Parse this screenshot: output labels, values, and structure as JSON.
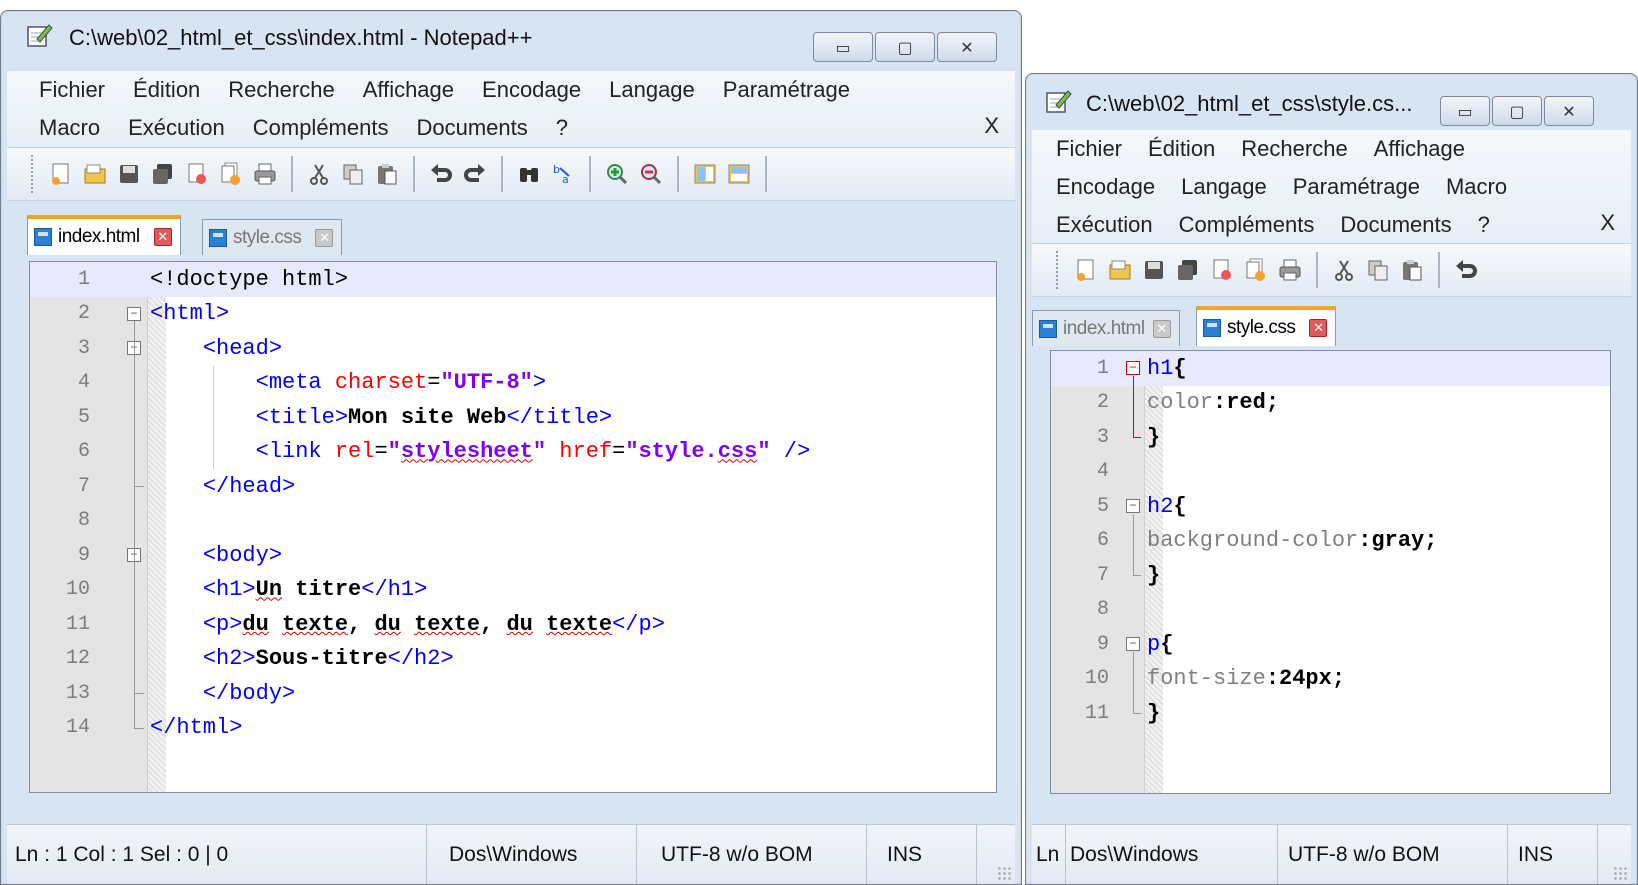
{
  "window1": {
    "title": "C:\\web\\02_html_et_css\\index.html - Notepad++",
    "controls": [
      "▭",
      "▢",
      "✕"
    ],
    "menu_row1": [
      "Fichier",
      "Édition",
      "Recherche",
      "Affichage",
      "Encodage",
      "Langage",
      "Paramétrage"
    ],
    "menu_row2": [
      "Macro",
      "Exécution",
      "Compléments",
      "Documents",
      "?"
    ],
    "menu_close": "X",
    "tabs": [
      {
        "label": "index.html",
        "active": true
      },
      {
        "label": "style.css",
        "active": false
      }
    ],
    "line_numbers": [
      "1",
      "2",
      "3",
      "4",
      "5",
      "6",
      "7",
      "8",
      "9",
      "10",
      "11",
      "12",
      "13",
      "14"
    ],
    "code_lines": [
      "<!doctype html>",
      "<html>",
      "    <head>",
      "        <meta charset=\"UTF-8\">",
      "        <title>Mon site Web</title>",
      "        <link rel=\"stylesheet\" href=\"style.css\" />",
      "    </head>",
      "",
      "    <body>",
      "    <h1>Un titre</h1>",
      "    <p>du texte, du texte, du texte</p>",
      "    <h2>Sous-titre</h2>",
      "    </body>",
      "</html>"
    ],
    "status": {
      "position": "Ln : 1    Col : 1    Sel : 0 | 0",
      "eol": "Dos\\Windows",
      "encoding": "UTF-8 w/o BOM",
      "mode": "INS"
    }
  },
  "window2": {
    "title": "C:\\web\\02_html_et_css\\style.cs...",
    "controls": [
      "▭",
      "▢",
      "✕"
    ],
    "menu_row1": [
      "Fichier",
      "Édition",
      "Recherche",
      "Affichage"
    ],
    "menu_row2": [
      "Encodage",
      "Langage",
      "Paramétrage",
      "Macro"
    ],
    "menu_row3": [
      "Exécution",
      "Compléments",
      "Documents",
      "?"
    ],
    "menu_close": "X",
    "tabs": [
      {
        "label": "index.html",
        "active": false
      },
      {
        "label": "style.css",
        "active": true
      }
    ],
    "line_numbers": [
      "1",
      "2",
      "3",
      "4",
      "5",
      "6",
      "7",
      "8",
      "9",
      "10",
      "11"
    ],
    "code_lines": [
      "h1{",
      "color:red;",
      "}",
      "",
      "h2{",
      "background-color:gray;",
      "}",
      "",
      "p{",
      "font-size:24px;",
      "}"
    ],
    "status": {
      "position": "Ln",
      "eol": "Dos\\Windows",
      "encoding": "UTF-8 w/o BOM",
      "mode": "INS"
    }
  },
  "toolbar_icons": [
    "new-file-icon",
    "open-file-icon",
    "save-icon",
    "save-all-icon",
    "close-icon",
    "close-all-icon",
    "print-icon",
    "cut-icon",
    "copy-icon",
    "paste-icon",
    "undo-icon",
    "redo-icon",
    "find-icon",
    "replace-icon",
    "zoom-in-icon",
    "zoom-out-icon",
    "sync-v-icon",
    "sync-h-icon"
  ]
}
